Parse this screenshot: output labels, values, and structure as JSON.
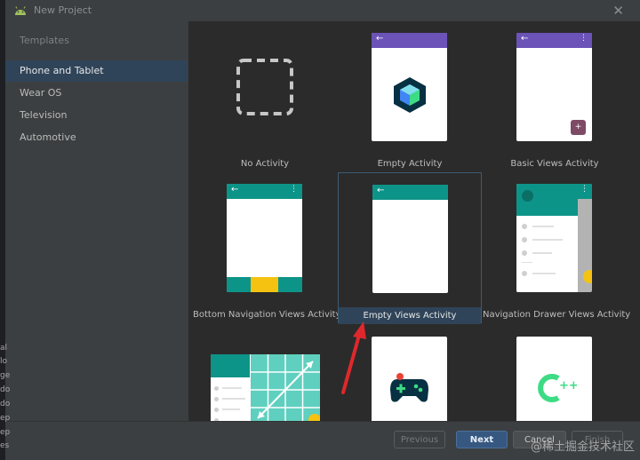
{
  "window": {
    "title": "New Project",
    "close_label": "✕"
  },
  "sidebar": {
    "header": "Templates",
    "items": [
      {
        "label": "Phone and Tablet",
        "selected": true
      },
      {
        "label": "Wear OS",
        "selected": false
      },
      {
        "label": "Television",
        "selected": false
      },
      {
        "label": "Automotive",
        "selected": false
      }
    ]
  },
  "templates": [
    {
      "label": "No Activity"
    },
    {
      "label": "Empty Activity"
    },
    {
      "label": "Basic Views Activity"
    },
    {
      "label": "Bottom Navigation Views Activity"
    },
    {
      "label": "Empty Views Activity",
      "selected": true
    },
    {
      "label": "Navigation Drawer Views Activity"
    },
    {
      "label": ""
    },
    {
      "label": ""
    },
    {
      "label": ""
    }
  ],
  "buttons": {
    "previous": "Previous",
    "next": "Next",
    "cancel": "Cancel",
    "finish": "Finish"
  },
  "background_text": [
    "al",
    "lo",
    "ge",
    "do",
    "do",
    "ep",
    "ep",
    "es"
  ],
  "watermark": "@稀土掘金技术社区",
  "colors": {
    "purple_appbar": "#6b53b8",
    "teal_appbar": "#0d9488",
    "selected_bg": "#2f4459",
    "next_button": "#365880"
  }
}
